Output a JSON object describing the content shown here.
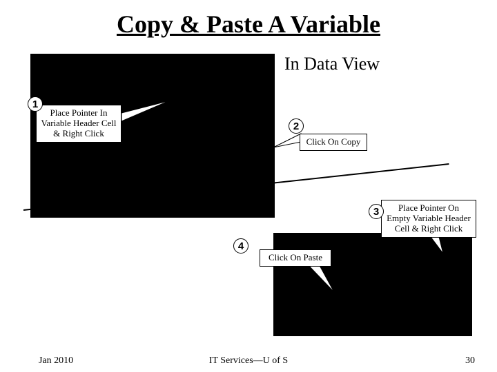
{
  "title": "Copy & Paste A Variable",
  "subtitle": "In Data View",
  "steps": {
    "1": {
      "num": "1",
      "text": "Place Pointer In Variable Header Cell & Right Click"
    },
    "2": {
      "num": "2",
      "text": "Click On Copy"
    },
    "3": {
      "num": "3",
      "text": "Place Pointer On Empty Variable Header Cell & Right Click"
    },
    "4": {
      "num": "4",
      "text": "Click On Paste"
    }
  },
  "footer": {
    "left": "Jan 2010",
    "center": "IT Services—U of S",
    "right": "30"
  }
}
